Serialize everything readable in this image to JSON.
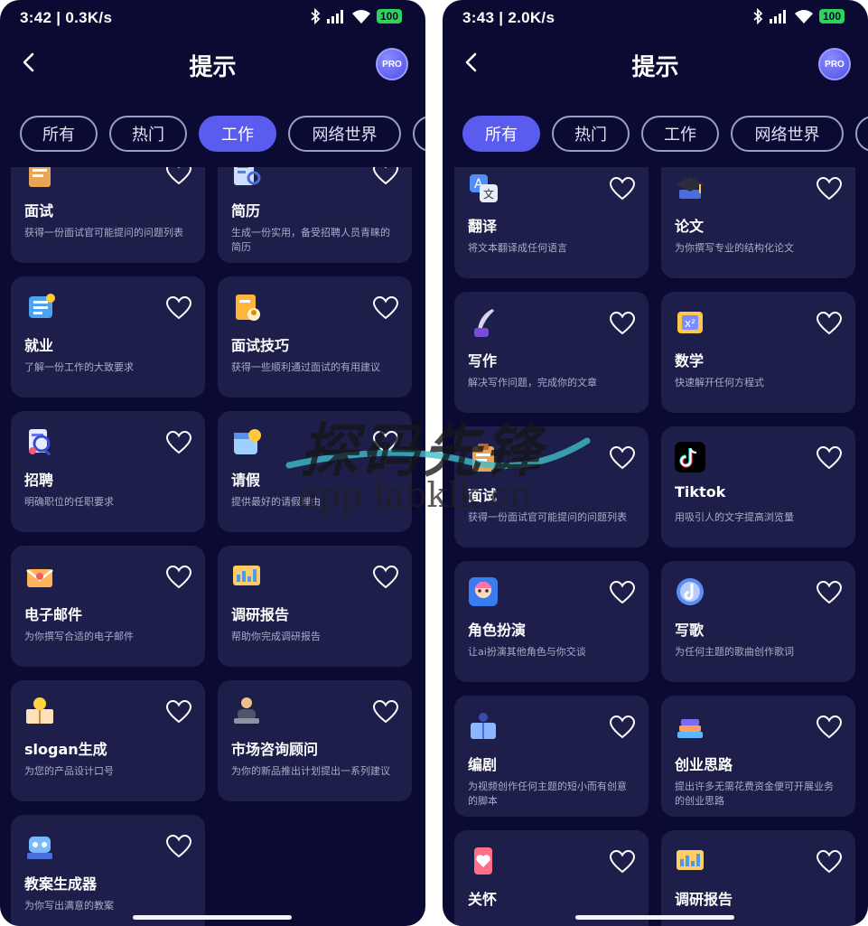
{
  "common": {
    "page_title": "提示",
    "pro_label": "PRO",
    "battery": "100"
  },
  "left": {
    "status_time": "3:42 | 0.3K/s",
    "tabs": [
      {
        "label": "所有",
        "active": false
      },
      {
        "label": "热门",
        "active": false
      },
      {
        "label": "工作",
        "active": true
      },
      {
        "label": "网络世界",
        "active": false
      }
    ],
    "cards": [
      {
        "title": "面试",
        "desc": "获得一份面试官可能提问的问题列表",
        "icon": "clipboard-icon"
      },
      {
        "title": "简历",
        "desc": "生成一份实用，备受招聘人员青睐的简历",
        "icon": "resume-search-icon"
      },
      {
        "title": "就业",
        "desc": "了解一份工作的大致要求",
        "icon": "checklist-icon"
      },
      {
        "title": "面试技巧",
        "desc": "获得一些顺利通过面试的有用建议",
        "icon": "document-user-icon"
      },
      {
        "title": "招聘",
        "desc": "明确职位的任职要求",
        "icon": "magnifier-doc-icon"
      },
      {
        "title": "请假",
        "desc": "提供最好的请假理由",
        "icon": "calendar-moon-icon"
      },
      {
        "title": "电子邮件",
        "desc": "为你撰写合适的电子邮件",
        "icon": "envelope-icon"
      },
      {
        "title": "调研报告",
        "desc": "帮助你完成调研报告",
        "icon": "chart-board-icon"
      },
      {
        "title": "slogan生成",
        "desc": "为您的产品设计口号",
        "icon": "book-bulb-icon"
      },
      {
        "title": "市场咨询顾问",
        "desc": "为你的新品推出计划提出一系列建议",
        "icon": "consultant-icon"
      },
      {
        "title": "教案生成器",
        "desc": "为你写出满意的教案",
        "icon": "robot-book-icon"
      }
    ]
  },
  "right": {
    "status_time": "3:43 | 2.0K/s",
    "tabs": [
      {
        "label": "所有",
        "active": true
      },
      {
        "label": "热门",
        "active": false
      },
      {
        "label": "工作",
        "active": false
      },
      {
        "label": "网络世界",
        "active": false
      }
    ],
    "cards": [
      {
        "title": "翻译",
        "desc": "将文本翻译成任何语言",
        "icon": "translate-icon"
      },
      {
        "title": "论文",
        "desc": "为你撰写专业的结构化论文",
        "icon": "graduation-cap-icon"
      },
      {
        "title": "写作",
        "desc": "解决写作问题，完成你的文章",
        "icon": "quill-ink-icon"
      },
      {
        "title": "数学",
        "desc": "快速解开任何方程式",
        "icon": "math-note-icon"
      },
      {
        "title": "面试",
        "desc": "获得一份面试官可能提问的问题列表",
        "icon": "clipboard-icon"
      },
      {
        "title": "Tiktok",
        "desc": "用吸引人的文字提高浏览量",
        "icon": "tiktok-icon"
      },
      {
        "title": "角色扮演",
        "desc": "让ai扮演其他角色与你交谈",
        "icon": "character-icon"
      },
      {
        "title": "写歌",
        "desc": "为任何主题的歌曲创作歌词",
        "icon": "music-note-icon"
      },
      {
        "title": "编剧",
        "desc": "为视频创作任何主题的短小而有创意的脚本",
        "icon": "script-book-icon"
      },
      {
        "title": "创业思路",
        "desc": "提出许多无需花费资金便可开展业务的创业思路",
        "icon": "book-stack-icon"
      },
      {
        "title": "关怀",
        "desc": "",
        "icon": "care-phone-icon"
      },
      {
        "title": "调研报告",
        "desc": "",
        "icon": "chart-board-icon"
      }
    ]
  },
  "watermark": {
    "main": "探码先锋",
    "sub": "app.labklk.cn"
  }
}
